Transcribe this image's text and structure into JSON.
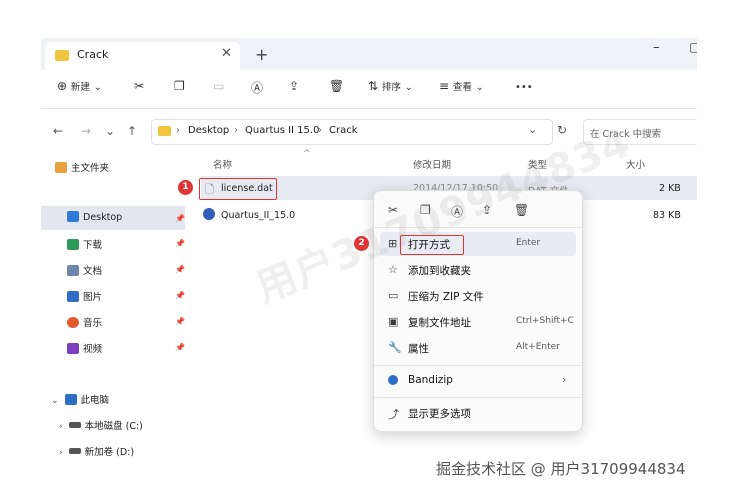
{
  "tab": {
    "title": "Crack",
    "close": "✕",
    "new": "+"
  },
  "window_controls": {
    "minimize": "–",
    "maximize": "▢"
  },
  "toolbar": {
    "new_label": "新建",
    "sort_label": "排序",
    "view_label": "查看",
    "more": "•••"
  },
  "address": {
    "crumbs": [
      "Desktop",
      "Quartus II 15.0",
      "Crack"
    ],
    "sep": "›",
    "search_placeholder": "在 Crack 中搜索"
  },
  "sidebar": {
    "items": [
      {
        "label": "主文件夹",
        "icon": "home-icon",
        "color": "#e9a23b"
      },
      {
        "label": "Desktop",
        "icon": "desktop-icon",
        "color": "#2e7bd6"
      },
      {
        "label": "下载",
        "icon": "download-icon",
        "color": "#2e9b5c"
      },
      {
        "label": "文档",
        "icon": "document-icon",
        "color": "#6f86b0"
      },
      {
        "label": "图片",
        "icon": "pictures-icon",
        "color": "#2f6ec7"
      },
      {
        "label": "音乐",
        "icon": "music-icon",
        "color": "#e25a2b"
      },
      {
        "label": "视频",
        "icon": "video-icon",
        "color": "#7d3fbf"
      },
      {
        "label": "此电脑",
        "icon": "this-pc-icon",
        "color": "#2f6ec7"
      },
      {
        "label": "本地磁盘 (C:)",
        "icon": "drive-icon",
        "color": "#555555"
      },
      {
        "label": "新加卷 (D:)",
        "icon": "drive-icon",
        "color": "#555555"
      }
    ]
  },
  "columns": {
    "name": "名称",
    "date": "修改日期",
    "type": "类型",
    "size": "大小"
  },
  "files": [
    {
      "name": "license.dat",
      "date": "2014/12/17 10:50",
      "type": "DAT 文件",
      "size": "2 KB"
    },
    {
      "name": "Quartus_II_15.0",
      "date": "",
      "type": "",
      "size": "83 KB"
    }
  ],
  "context_menu": {
    "items": [
      {
        "label": "打开方式",
        "shortcut": "Enter",
        "icon": "open-with-icon"
      },
      {
        "label": "添加到收藏夹",
        "shortcut": "",
        "icon": "star-icon"
      },
      {
        "label": "压缩为 ZIP 文件",
        "shortcut": "",
        "icon": "zip-icon"
      },
      {
        "label": "复制文件地址",
        "shortcut": "Ctrl+Shift+C",
        "icon": "copy-path-icon"
      },
      {
        "label": "属性",
        "shortcut": "Alt+Enter",
        "icon": "properties-icon"
      },
      {
        "label": "Bandizip",
        "shortcut": "",
        "icon": "bandizip-icon"
      },
      {
        "label": "显示更多选项",
        "shortcut": "",
        "icon": "more-options-icon"
      }
    ]
  },
  "annotations": {
    "step1": "1",
    "step2": "2"
  },
  "watermark": "用户31709944834",
  "footer_watermark": "掘金技术社区 @ 用户31709944834",
  "colors": {
    "accent": "#e03535",
    "folder": "#f0c43c",
    "selection": "#e7eaf0"
  }
}
